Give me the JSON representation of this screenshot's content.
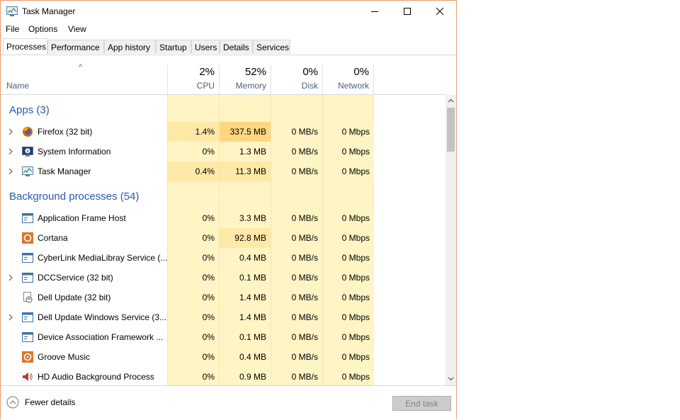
{
  "window": {
    "title": "Task Manager"
  },
  "menu": [
    "File",
    "Options",
    "View"
  ],
  "tabs": [
    "Processes",
    "Performance",
    "App history",
    "Startup",
    "Users",
    "Details",
    "Services"
  ],
  "active_tab": "Processes",
  "columns": {
    "name": "Name",
    "cpu": {
      "pct": "2%",
      "label": "CPU"
    },
    "memory": {
      "pct": "52%",
      "label": "Memory"
    },
    "disk": {
      "pct": "0%",
      "label": "Disk"
    },
    "network": {
      "pct": "0%",
      "label": "Network"
    }
  },
  "groups": {
    "apps": "Apps (3)",
    "background": "Background processes (54)"
  },
  "rows": [
    {
      "name": "Firefox (32 bit)",
      "cpu": "1.4%",
      "memory": "337.5 MB",
      "disk": "0 MB/s",
      "network": "0 Mbps",
      "icon": "firefox-icon",
      "expand": true
    },
    {
      "name": "System Information",
      "cpu": "0%",
      "memory": "1.3 MB",
      "disk": "0 MB/s",
      "network": "0 Mbps",
      "icon": "system-information-icon",
      "expand": true
    },
    {
      "name": "Task Manager",
      "cpu": "0.4%",
      "memory": "11.3 MB",
      "disk": "0 MB/s",
      "network": "0 Mbps",
      "icon": "task-manager-icon",
      "expand": true
    },
    {
      "name": "Application Frame Host",
      "cpu": "0%",
      "memory": "3.3 MB",
      "disk": "0 MB/s",
      "network": "0 Mbps",
      "icon": "window-icon",
      "expand": false
    },
    {
      "name": "Cortana",
      "cpu": "0%",
      "memory": "92.8 MB",
      "disk": "0 MB/s",
      "network": "0 Mbps",
      "icon": "cortana-icon",
      "expand": false
    },
    {
      "name": "CyberLink MediaLibray Service (...",
      "cpu": "0%",
      "memory": "0.4 MB",
      "disk": "0 MB/s",
      "network": "0 Mbps",
      "icon": "window-icon",
      "expand": false
    },
    {
      "name": "DCCService (32 bit)",
      "cpu": "0%",
      "memory": "0.1 MB",
      "disk": "0 MB/s",
      "network": "0 Mbps",
      "icon": "window-icon",
      "expand": true
    },
    {
      "name": "Dell Update (32 bit)",
      "cpu": "0%",
      "memory": "1.4 MB",
      "disk": "0 MB/s",
      "network": "0 Mbps",
      "icon": "dell-update-icon",
      "expand": false
    },
    {
      "name": "Dell Update Windows Service (3...",
      "cpu": "0%",
      "memory": "1.4 MB",
      "disk": "0 MB/s",
      "network": "0 Mbps",
      "icon": "window-icon",
      "expand": true
    },
    {
      "name": "Device Association Framework ...",
      "cpu": "0%",
      "memory": "0.1 MB",
      "disk": "0 MB/s",
      "network": "0 Mbps",
      "icon": "window-icon",
      "expand": false
    },
    {
      "name": "Groove Music",
      "cpu": "0%",
      "memory": "0.4 MB",
      "disk": "0 MB/s",
      "network": "0 Mbps",
      "icon": "groove-music-icon",
      "expand": false
    },
    {
      "name": "HD Audio Background Process",
      "cpu": "0%",
      "memory": "0.9 MB",
      "disk": "0 MB/s",
      "network": "0 Mbps",
      "icon": "speaker-icon",
      "expand": false
    }
  ],
  "footer": {
    "fewer_details": "Fewer details",
    "end_task": "End task"
  },
  "colors": {
    "accent_blue": "#2a5aa8",
    "heat_light": "#fff4c4",
    "heat_medium": "#ffe9a8",
    "heat_high": "#ffd780"
  }
}
